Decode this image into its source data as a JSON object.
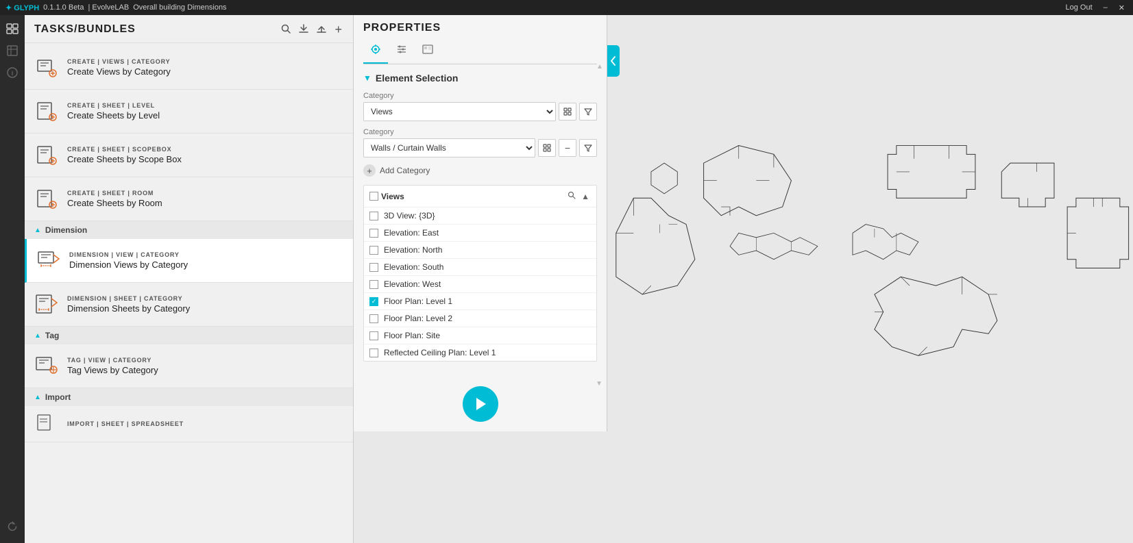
{
  "titlebar": {
    "logo": "✦ GLYPH",
    "version": "0.1.1.0 Beta",
    "company": "| EvolveLAB",
    "title": "Overall building Dimensions",
    "logout": "Log Out",
    "minimize": "–",
    "close": "✕"
  },
  "tasks_panel": {
    "title": "TASKS/BUNDLES",
    "icons": {
      "search": "🔍",
      "download": "⬇",
      "upload": "⬆",
      "add": "+"
    },
    "sections": [
      {
        "name": "create_views_item",
        "label": "CREATE | VIEWS | CATEGORY",
        "name_text": "Create Views by Category",
        "active": false
      }
    ],
    "create_section": {
      "items": [
        {
          "label": "CREATE | SHEET | LEVEL",
          "name_text": "Create Sheets by Level"
        },
        {
          "label": "CREATE | SHEET | SCOPEBOX",
          "name_text": "Create Sheets by Scope Box"
        },
        {
          "label": "CREATE | SHEET | ROOM",
          "name_text": "Create Sheets by Room"
        }
      ]
    },
    "dimension_section": {
      "title": "Dimension",
      "items": [
        {
          "label": "DIMENSION | VIEW | CATEGORY",
          "name_text": "Dimension Views by Category",
          "active": true
        },
        {
          "label": "DIMENSION | SHEET | CATEGORY",
          "name_text": "Dimension Sheets by Category"
        }
      ]
    },
    "tag_section": {
      "title": "Tag",
      "items": [
        {
          "label": "TAG | VIEW | CATEGORY",
          "name_text": "Tag Views by Category"
        }
      ]
    },
    "import_section": {
      "title": "Import",
      "items": [
        {
          "label": "IMPORT | SHEET | SPREADSHEET",
          "name_text": ""
        }
      ]
    }
  },
  "properties_panel": {
    "title": "PROPERTIES",
    "tabs": [
      {
        "icon": "✦",
        "active": true
      },
      {
        "icon": "≡",
        "active": false
      },
      {
        "icon": "▣",
        "active": false
      }
    ],
    "element_selection": {
      "title": "Element Selection",
      "categories": [
        {
          "label": "Category",
          "value": "Views",
          "placeholder": "Views"
        },
        {
          "label": "Category",
          "value": "Walls / Curtain Walls",
          "placeholder": "Walls / Curtain Walls"
        }
      ],
      "add_category": "Add Category"
    },
    "views": {
      "header": "Views",
      "items": [
        {
          "label": "3D View: {3D}",
          "checked": false
        },
        {
          "label": "Elevation: East",
          "checked": false
        },
        {
          "label": "Elevation: North",
          "checked": false
        },
        {
          "label": "Elevation: South",
          "checked": false
        },
        {
          "label": "Elevation: West",
          "checked": false
        },
        {
          "label": "Floor Plan: Level 1",
          "checked": true
        },
        {
          "label": "Floor Plan: Level 2",
          "checked": false
        },
        {
          "label": "Floor Plan: Site",
          "checked": false
        },
        {
          "label": "Reflected Ceiling Plan: Level 1",
          "checked": false
        }
      ]
    },
    "run_button": "▶"
  }
}
